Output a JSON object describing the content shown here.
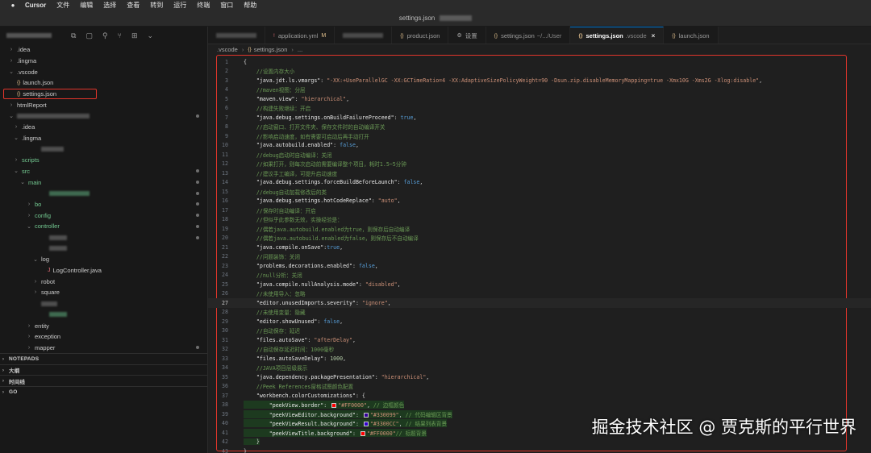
{
  "menubar": {
    "apple": "",
    "items": [
      "Cursor",
      "文件",
      "编辑",
      "选择",
      "查看",
      "转到",
      "运行",
      "终端",
      "窗口",
      "帮助"
    ]
  },
  "window": {
    "title": "settings.json"
  },
  "sidebar": {
    "rows": [
      {
        "indent": 10,
        "chev": "›",
        "label": ".idea",
        "kind": "folder"
      },
      {
        "indent": 10,
        "chev": "›",
        "label": ".lingma",
        "kind": "folder"
      },
      {
        "indent": 10,
        "chev": "⌄",
        "label": ".vscode",
        "kind": "folder"
      },
      {
        "indent": 10,
        "chev": "",
        "label": "launch.json",
        "kind": "json"
      },
      {
        "indent": 10,
        "chev": "",
        "label": "settings.json",
        "kind": "json",
        "selected": true
      },
      {
        "indent": 10,
        "chev": "›",
        "label": "htmlReport",
        "kind": "folder"
      },
      {
        "indent": 10,
        "chev": "⌄",
        "label": "",
        "kind": "blur",
        "blurw": 90,
        "dot": true
      },
      {
        "indent": 16,
        "chev": "›",
        "label": ".idea",
        "kind": "folder"
      },
      {
        "indent": 16,
        "chev": "⌄",
        "label": ".lingma",
        "kind": "folder"
      },
      {
        "indent": 40,
        "chev": "",
        "label": "",
        "kind": "blur",
        "blurw": 28
      },
      {
        "indent": 16,
        "chev": "›",
        "label": "scripts",
        "kind": "folder",
        "green": true
      },
      {
        "indent": 16,
        "chev": "⌄",
        "label": "src",
        "kind": "folder",
        "green": true,
        "dot": true
      },
      {
        "indent": 24,
        "chev": "⌄",
        "label": "main",
        "kind": "folder",
        "green": true,
        "dot": true
      },
      {
        "indent": 50,
        "chev": "",
        "label": "",
        "kind": "blur",
        "blurw": 50,
        "green": true,
        "dot": true
      },
      {
        "indent": 32,
        "chev": "›",
        "label": "bo",
        "kind": "folder",
        "green": true,
        "dot": true
      },
      {
        "indent": 32,
        "chev": "›",
        "label": "config",
        "kind": "folder",
        "green": true,
        "dot": true
      },
      {
        "indent": 32,
        "chev": "⌄",
        "label": "controller",
        "kind": "folder",
        "green": true,
        "dot": true
      },
      {
        "indent": 50,
        "chev": "",
        "label": "",
        "kind": "blur",
        "blurw": 22,
        "dot": true
      },
      {
        "indent": 50,
        "chev": "",
        "label": "",
        "kind": "blur",
        "blurw": 22
      },
      {
        "indent": 40,
        "chev": "⌄",
        "label": "log",
        "kind": "folder"
      },
      {
        "indent": 48,
        "chev": "",
        "label": "LogController.java",
        "kind": "java"
      },
      {
        "indent": 40,
        "chev": "›",
        "label": "robot",
        "kind": "folder"
      },
      {
        "indent": 40,
        "chev": "›",
        "label": "square",
        "kind": "folder"
      },
      {
        "indent": 40,
        "chev": "",
        "label": "",
        "kind": "blur",
        "blurw": 20
      },
      {
        "indent": 50,
        "chev": "",
        "label": "",
        "kind": "blur",
        "blurw": 22,
        "green": true
      },
      {
        "indent": 32,
        "chev": "›",
        "label": "entity",
        "kind": "folder"
      },
      {
        "indent": 32,
        "chev": "›",
        "label": "exception",
        "kind": "folder"
      },
      {
        "indent": 32,
        "chev": "›",
        "label": "mapper",
        "kind": "folder",
        "dot": true
      }
    ],
    "sections": [
      "NOTEPADS",
      "大纲",
      "时间线",
      "GO"
    ]
  },
  "tabs": [
    {
      "kind": "blur",
      "label": ""
    },
    {
      "kind": "yml",
      "label": "application.yml",
      "mod": "M"
    },
    {
      "kind": "blur",
      "label": ""
    },
    {
      "kind": "json",
      "label": "product.json"
    },
    {
      "kind": "gear",
      "label": "设置"
    },
    {
      "kind": "json",
      "label": "settings.json",
      "dim": "~/.../User"
    },
    {
      "kind": "json",
      "label": "settings.json",
      "dim": ".vscode",
      "active": true,
      "close": "×"
    },
    {
      "kind": "json",
      "label": "launch.json"
    }
  ],
  "breadcrumb": {
    "folder": ".vscode",
    "sep": "›",
    "file": "settings.json",
    "tail": "..."
  },
  "editor": {
    "current_line": 27,
    "lines": [
      [
        [
          "k",
          "{"
        ]
      ],
      [
        [
          "cm",
          "    //设置内存大小"
        ]
      ],
      [
        [
          "key",
          "    \"java.jdt.ls.vmargs\""
        ],
        [
          "k",
          ": "
        ],
        [
          "str",
          "\"-XX:+UseParallelGC -XX:GCTimeRatio=4 -XX:AdaptiveSizePolicyWeight=90 -Dsun.zip.disableMemoryMapping=true -Xmx10G -Xms2G -Xlog:disable\""
        ],
        [
          "k",
          ","
        ]
      ],
      [
        [
          "cm",
          "    //maven视图：分层"
        ]
      ],
      [
        [
          "key",
          "    \"maven.view\""
        ],
        [
          "k",
          ": "
        ],
        [
          "str",
          "\"hierarchical\""
        ],
        [
          "k",
          ","
        ]
      ],
      [
        [
          "cm",
          "    //构建失败继续：开启"
        ]
      ],
      [
        [
          "key",
          "    \"java.debug.settings.onBuildFailureProceed\""
        ],
        [
          "k",
          ": "
        ],
        [
          "kw",
          "true"
        ],
        [
          "k",
          ","
        ]
      ],
      [
        [
          "cm",
          "    //启动窗口、打开文件夹、保存文件时的自动编译开关"
        ]
      ],
      [
        [
          "cm",
          "    //影响启动速度，如有需要可启动后再手动打开"
        ]
      ],
      [
        [
          "key",
          "    \"java.autobuild.enabled\""
        ],
        [
          "k",
          ": "
        ],
        [
          "kw",
          "false"
        ],
        [
          "k",
          ","
        ]
      ],
      [
        [
          "cm",
          "    //debug启动时自动编译：关闭"
        ]
      ],
      [
        [
          "cm",
          "    //如果打开，则每次启动前需要编译整个项目，耗时1.5~5分钟"
        ]
      ],
      [
        [
          "cm",
          "    //建议手工编译，可提升启动速度"
        ]
      ],
      [
        [
          "key",
          "    \"java.debug.settings.forceBuildBeforeLaunch\""
        ],
        [
          "k",
          ": "
        ],
        [
          "kw",
          "false"
        ],
        [
          "k",
          ","
        ]
      ],
      [
        [
          "cm",
          "    //debug自动加载修改后的类"
        ]
      ],
      [
        [
          "key",
          "    \"java.debug.settings.hotCodeReplace\""
        ],
        [
          "k",
          ": "
        ],
        [
          "str",
          "\"auto\""
        ],
        [
          "k",
          ","
        ]
      ],
      [
        [
          "cm",
          "    //保存时自动编译：开启"
        ]
      ],
      [
        [
          "cm",
          "    //但似乎此参数无效，实操经验是："
        ]
      ],
      [
        [
          "cm",
          "    //偶若java.autobuild.enabled为true，则保存后自动编译"
        ]
      ],
      [
        [
          "cm",
          "    //偶若java.autobuild.enabled为false，则保存后不自动编译"
        ]
      ],
      [
        [
          "key",
          "    \"java.compile.onSave\""
        ],
        [
          "k",
          ":"
        ],
        [
          "kw",
          "true"
        ],
        [
          "k",
          ","
        ]
      ],
      [
        [
          "cm",
          "    //问题装饰：关闭"
        ]
      ],
      [
        [
          "key",
          "    \"problems.decorations.enabled\""
        ],
        [
          "k",
          ": "
        ],
        [
          "kw",
          "false"
        ],
        [
          "k",
          ","
        ]
      ],
      [
        [
          "cm",
          "    //null分析：关闭"
        ]
      ],
      [
        [
          "key",
          "    \"java.compile.nullAnalysis.mode\""
        ],
        [
          "k",
          ": "
        ],
        [
          "str",
          "\"disabled\""
        ],
        [
          "k",
          ","
        ]
      ],
      [
        [
          "cm",
          "    //未使用导入：忽略"
        ]
      ],
      [
        [
          "key",
          "    \"editor.unusedImports.severity\""
        ],
        [
          "k",
          ": "
        ],
        [
          "str",
          "\"ignore\""
        ],
        [
          "k",
          ","
        ]
      ],
      [
        [
          "cm",
          "    //未使用变量：隐藏"
        ]
      ],
      [
        [
          "key",
          "    \"editor.showUnused\""
        ],
        [
          "k",
          ": "
        ],
        [
          "kw",
          "false"
        ],
        [
          "k",
          ","
        ]
      ],
      [
        [
          "cm",
          "    //自动保存：延迟"
        ]
      ],
      [
        [
          "key",
          "    \"files.autoSave\""
        ],
        [
          "k",
          ": "
        ],
        [
          "str",
          "\"afterDelay\""
        ],
        [
          "k",
          ","
        ]
      ],
      [
        [
          "cm",
          "    //自动保存延迟时间：1000毫秒"
        ]
      ],
      [
        [
          "key",
          "    \"files.autoSaveDelay\""
        ],
        [
          "k",
          ": "
        ],
        [
          "num",
          "1000"
        ],
        [
          "k",
          ","
        ]
      ],
      [
        [
          "cm",
          "    //JAVA项目层级展示"
        ]
      ],
      [
        [
          "key",
          "    \"java.dependency.packagePresentation\""
        ],
        [
          "k",
          ": "
        ],
        [
          "str",
          "\"hierarchical\""
        ],
        [
          "k",
          ","
        ]
      ],
      [
        [
          "cm",
          "    //Peek References窗格试图颜色配置"
        ]
      ],
      [
        [
          "key",
          "    \"workbench.colorCustomizations\""
        ],
        [
          "k",
          ": {"
        ]
      ],
      [
        [
          "key",
          "        \"peekView.border\""
        ],
        [
          "k",
          ": "
        ],
        [
          "sw",
          "#FF0000"
        ],
        [
          "str",
          "\"#FF0000\""
        ],
        [
          "k",
          ", "
        ],
        [
          "cm",
          "// 边框颜色"
        ]
      ],
      [
        [
          "key",
          "        \"peekViewEditor.background\""
        ],
        [
          "k",
          ": "
        ],
        [
          "sw",
          "#330099"
        ],
        [
          "str",
          "\"#330099\""
        ],
        [
          "k",
          ", "
        ],
        [
          "cm",
          "// 代码编辑区背景"
        ]
      ],
      [
        [
          "key",
          "        \"peekViewResult.background\""
        ],
        [
          "k",
          ": "
        ],
        [
          "sw",
          "#3300CC"
        ],
        [
          "str",
          "\"#3300CC\""
        ],
        [
          "k",
          ", "
        ],
        [
          "cm",
          "// 结果列表背景"
        ]
      ],
      [
        [
          "key",
          "        \"peekViewTitle.background\""
        ],
        [
          "k",
          ": "
        ],
        [
          "sw",
          "#FF0000"
        ],
        [
          "str",
          "\"#FF0000\""
        ],
        [
          "cm",
          "// 标题背景"
        ]
      ],
      [
        [
          "k",
          "    }"
        ]
      ],
      [
        [
          "k",
          "}"
        ]
      ]
    ]
  },
  "watermark": "掘金技术社区 @ 贾克斯的平行世界"
}
